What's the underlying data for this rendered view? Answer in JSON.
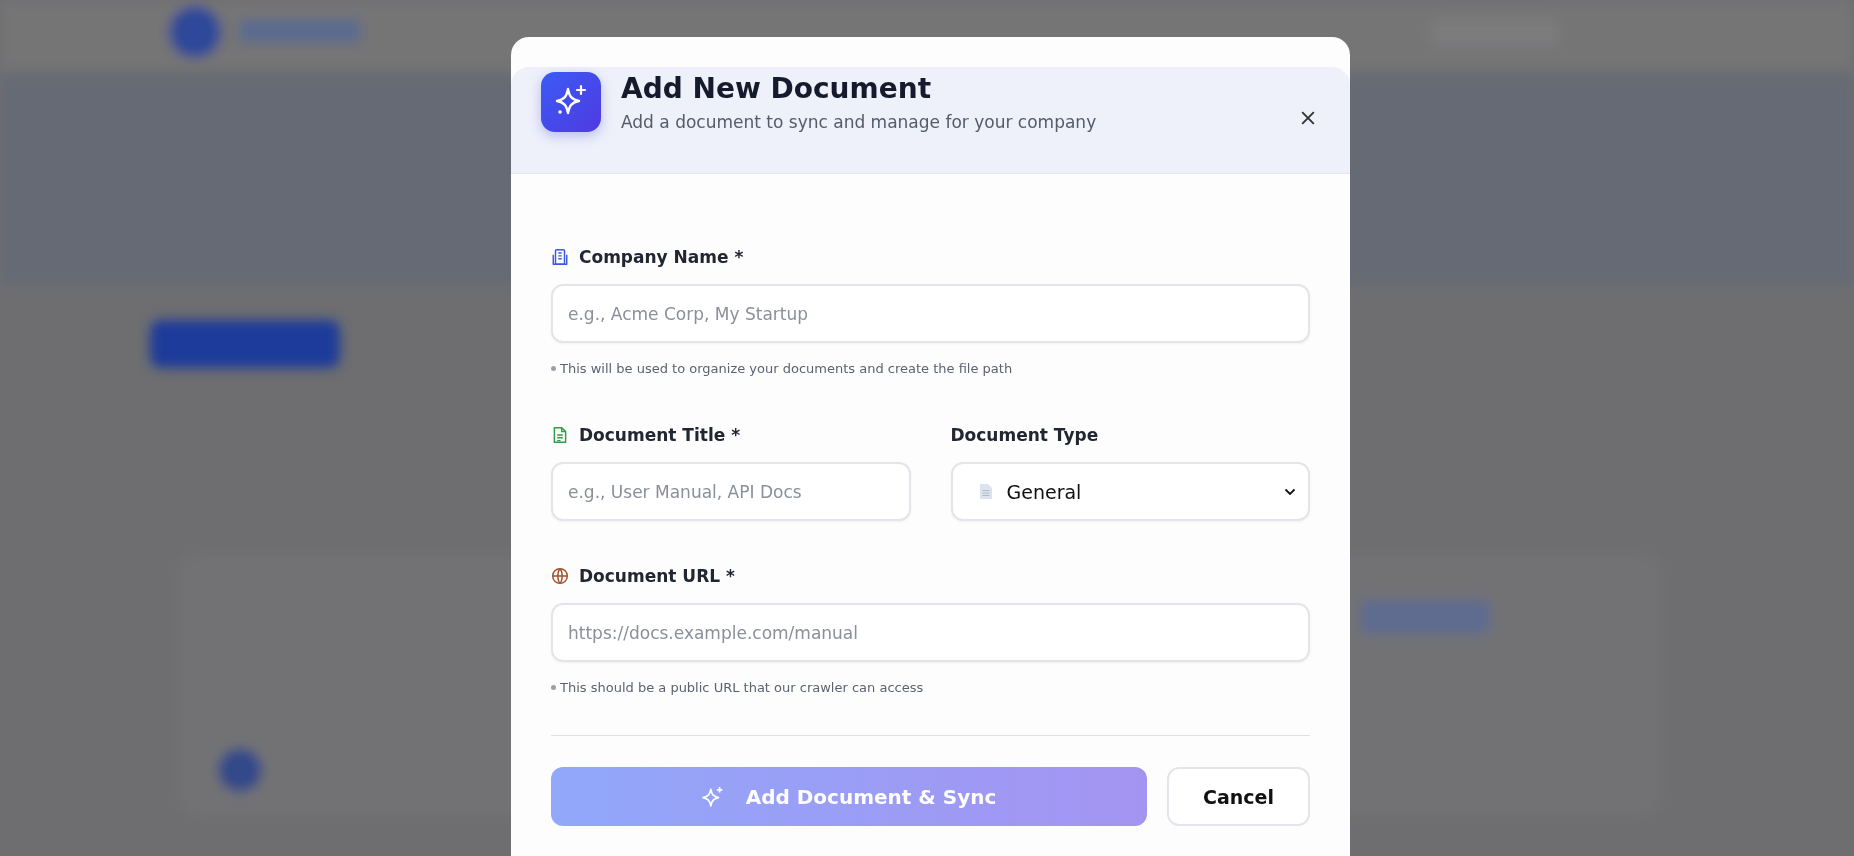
{
  "dialog": {
    "title": "Add New Document",
    "subtitle": "Add a document to sync and manage for your company",
    "fields": [
      {
        "kind": "text",
        "label": "Company Name *",
        "placeholder": "e.g., Acme Corp, My Startup",
        "hint": "This will be used to organize your documents and create the file path"
      },
      {
        "kind": "text",
        "label": "Document Title *",
        "placeholder": "e.g., User Manual, API Docs"
      },
      {
        "kind": "select",
        "label": "Document Type",
        "value": "General"
      },
      {
        "kind": "text",
        "label": "Document URL *",
        "placeholder": "https://docs.example.com/manual",
        "hint": "This should be a public URL that our crawler can access"
      }
    ],
    "submit": {
      "label": "Add Document & Sync",
      "disabled": true
    },
    "cancel": {
      "label": "Cancel"
    }
  }
}
